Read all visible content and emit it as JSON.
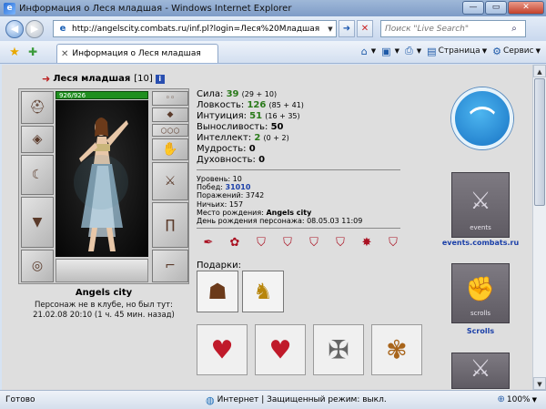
{
  "window": {
    "title": "Информация о Леся младшая - Windows Internet Explorer",
    "minimize": "—",
    "maximize": "▭",
    "close": "✕"
  },
  "address": {
    "url": "http://angelscity.combats.ru/inf.pl?login=Леся%20Младшая",
    "search_placeholder": "Поиск \"Live Search\""
  },
  "tab": {
    "label": "Информация о Леся младшая"
  },
  "commands": {
    "page": "Страница",
    "service": "Сервис"
  },
  "character": {
    "nick": "Леся младшая",
    "level": "[10]",
    "hp": "926/926",
    "city": "Angels city",
    "status_line1": "Персонаж не в клубе, но был тут:",
    "status_line2": "21.02.08 20:10 (1 ч. 45 мин. назад)"
  },
  "stats": {
    "strength": {
      "label": "Сила:",
      "value": "39",
      "extra": "(29 + 10)"
    },
    "agility": {
      "label": "Ловкость:",
      "value": "126",
      "extra": "(85 + 41)"
    },
    "intuition": {
      "label": "Интуиция:",
      "value": "51",
      "extra": "(16 + 35)"
    },
    "endurance": {
      "label": "Выносливость:",
      "value": "50"
    },
    "intellect": {
      "label": "Интеллект:",
      "value": "2",
      "extra": "(0 + 2)"
    },
    "wisdom": {
      "label": "Мудрость:",
      "value": "0"
    },
    "spirituality": {
      "label": "Духовность:",
      "value": "0"
    }
  },
  "info": {
    "level": {
      "label": "Уровень:",
      "value": "10"
    },
    "wins": {
      "label": "Побед:",
      "value": "31010"
    },
    "losses": {
      "label": "Поражений:",
      "value": "3742"
    },
    "draws": {
      "label": "Ничьих:",
      "value": "157"
    },
    "birthplace": {
      "label": "Место рождения:",
      "value": "Angels city"
    },
    "birthday": {
      "label": "День рождения персонажа:",
      "value": "08.05.03 11:09"
    }
  },
  "gifts": {
    "label": "Подарки:"
  },
  "links": {
    "events": "events.combats.ru",
    "scrolls": "Scrolls",
    "events_cap": "events",
    "scrolls_cap": "scrolls"
  },
  "statusbar": {
    "left": "Готово",
    "zone": "Интернет | Защищенный режим: выкл.",
    "zoom": "100%"
  }
}
